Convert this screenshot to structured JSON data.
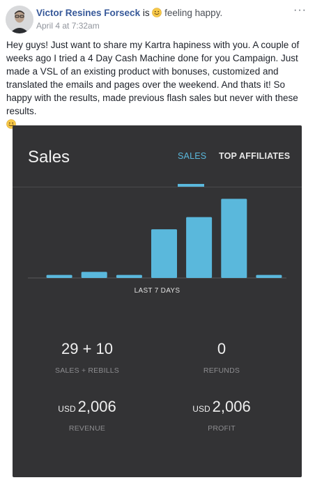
{
  "post": {
    "author": "Victor Resines Forseck",
    "is_word": "is",
    "feeling": "feeling happy.",
    "timestamp": "April 4 at 7:32am",
    "more_label": "···",
    "body": "Hey guys! Just want to share my Kartra hapiness with you. A couple of weeks ago I tried a 4 Day Cash Machine done for you Campaign. Just made a VSL of an existing product with bonuses, customized and translated the emails and pages over the weekend. And thats it! So happy with the results, made previous flash sales but never with these results."
  },
  "dashboard": {
    "title": "Sales",
    "tabs": [
      "SALES",
      "TOP AFFILIATES"
    ],
    "active_tab": "SALES",
    "chart_caption": "LAST 7 DAYS",
    "stats": [
      {
        "value": "29 + 10",
        "prefix": "",
        "label": "SALES + REBILLS"
      },
      {
        "value": "0",
        "prefix": "",
        "label": "REFUNDS"
      },
      {
        "value": "2,006",
        "prefix": "USD",
        "label": "REVENUE"
      },
      {
        "value": "2,006",
        "prefix": "USD",
        "label": "PROFIT"
      }
    ],
    "colors": {
      "accent": "#5ab8dc",
      "card_bg": "#333335",
      "author": "#365899"
    }
  },
  "chart_data": {
    "type": "bar",
    "categories": [
      "",
      "",
      "",
      "",
      "",
      "",
      ""
    ],
    "values": [
      1,
      2,
      1,
      16,
      20,
      26,
      1
    ],
    "xlabel": "LAST 7 DAYS",
    "ylabel": "",
    "ylim": [
      0,
      27
    ],
    "grid": false
  }
}
